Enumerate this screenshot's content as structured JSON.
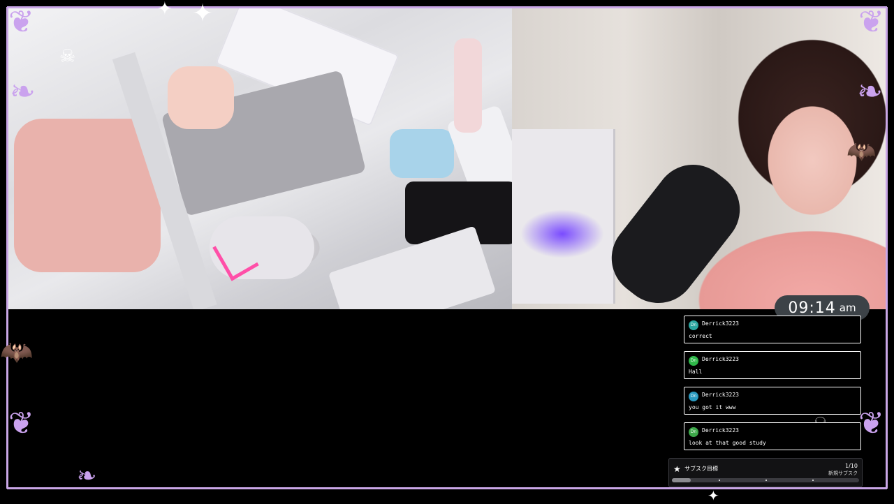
{
  "clock": {
    "time": "09:14",
    "period": "am"
  },
  "chat": {
    "messages": [
      {
        "badge": "Dn",
        "badge_color": "#2aa6a0",
        "user": "Derrick3223",
        "text": "correct"
      },
      {
        "badge": "Dn",
        "badge_color": "#2fb84a",
        "user": "Derrick3223",
        "text": "Hall"
      },
      {
        "badge": "Dn",
        "badge_color": "#2a9ac0",
        "user": "Derrick3223",
        "text": "you got it www"
      },
      {
        "badge": "Dn",
        "badge_color": "#3da84a",
        "user": "Derrick3223",
        "text": "look at that good study"
      }
    ]
  },
  "sub_goal": {
    "title": "サブスク目標",
    "count": "1/10",
    "label": "新規サブスク",
    "progress": 0.1
  },
  "colors": {
    "frame": "#c9a6e6",
    "background": "#000000",
    "clock_bg": "#3c4247"
  },
  "icons": [
    "skull-icon",
    "bat-icon",
    "sparkle-icon",
    "star-icon"
  ]
}
